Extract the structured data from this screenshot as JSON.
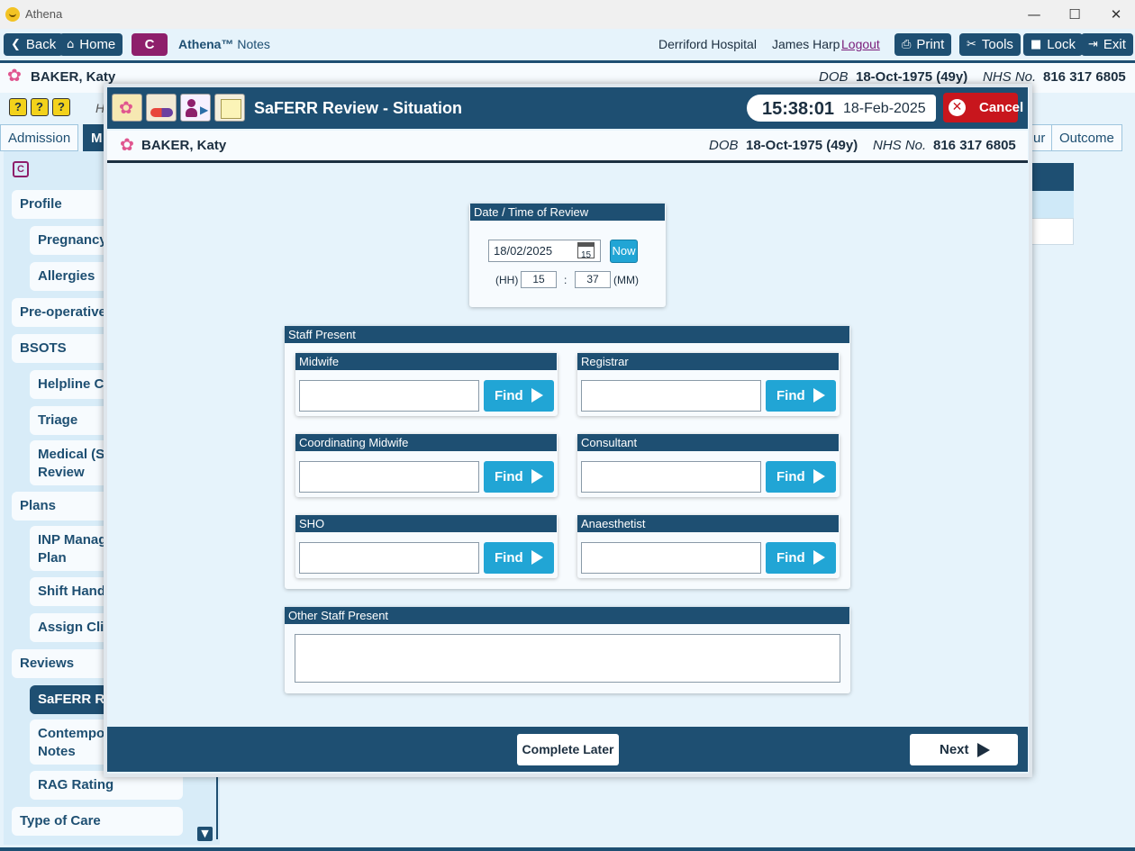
{
  "window": {
    "title": "Athena",
    "min": "—",
    "max": "☐",
    "close": "✕"
  },
  "toolbar": {
    "back": "Back",
    "home": "Home",
    "c_label": "C",
    "app_brand": "Athena™",
    "app_module": "Notes",
    "hospital": "Derriford Hospital",
    "user": "James Harp",
    "logout": "Logout",
    "print": "Print",
    "tools": "Tools",
    "lock": "Lock",
    "exit": "Exit"
  },
  "patient": {
    "name": "BAKER, Katy",
    "dob_label": "DOB",
    "dob": "18-Oct-1975 (49y)",
    "nhs_label": "NHS No.",
    "nhs": "816 317 6805"
  },
  "bg": {
    "h_letter": "H",
    "tabs": {
      "admission": "Admission",
      "active": "M",
      "partial": "ur",
      "outcome": "Outcome"
    },
    "icons": [
      "?",
      "?",
      "?"
    ]
  },
  "sidebar": {
    "items": [
      {
        "label": "Profile"
      },
      {
        "label": "Pregnancy"
      },
      {
        "label": "Allergies"
      },
      {
        "label": "Pre-operative"
      },
      {
        "label": "BSOTS"
      },
      {
        "label": "Helpline Co"
      },
      {
        "label": "Triage"
      },
      {
        "label": "Medical (Sa",
        "label2": "Review"
      },
      {
        "label": "Plans"
      },
      {
        "label": "INP Manag",
        "label2": "Plan"
      },
      {
        "label": "Shift Hando"
      },
      {
        "label": "Assign Clin"
      },
      {
        "label": "Reviews"
      },
      {
        "label": "SaFERR Rev"
      },
      {
        "label": "Contempor",
        "label2": "Notes"
      },
      {
        "label": "RAG Rating"
      },
      {
        "label": "Type of Care"
      }
    ]
  },
  "modal": {
    "title": "SaFERR Review - Situation",
    "time": "15:38:01",
    "date": "18-Feb-2025",
    "cancel": "Cancel",
    "review": {
      "header": "Date / Time of Review",
      "date_value": "18/02/2025",
      "cal_day": "15",
      "now": "Now",
      "hh_label": "(HH)",
      "hh": "15",
      "sep": ":",
      "mm": "37",
      "mm_label": "(MM)"
    },
    "staff": {
      "header": "Staff Present",
      "roles": [
        {
          "label": "Midwife",
          "value": ""
        },
        {
          "label": "Registrar",
          "value": ""
        },
        {
          "label": "Coordinating Midwife",
          "value": ""
        },
        {
          "label": "Consultant",
          "value": ""
        },
        {
          "label": "SHO",
          "value": ""
        },
        {
          "label": "Anaesthetist",
          "value": ""
        }
      ],
      "find": "Find"
    },
    "other": {
      "header": "Other Staff Present",
      "value": ""
    },
    "footer": {
      "complete_later": "Complete Later",
      "next": "Next"
    }
  }
}
